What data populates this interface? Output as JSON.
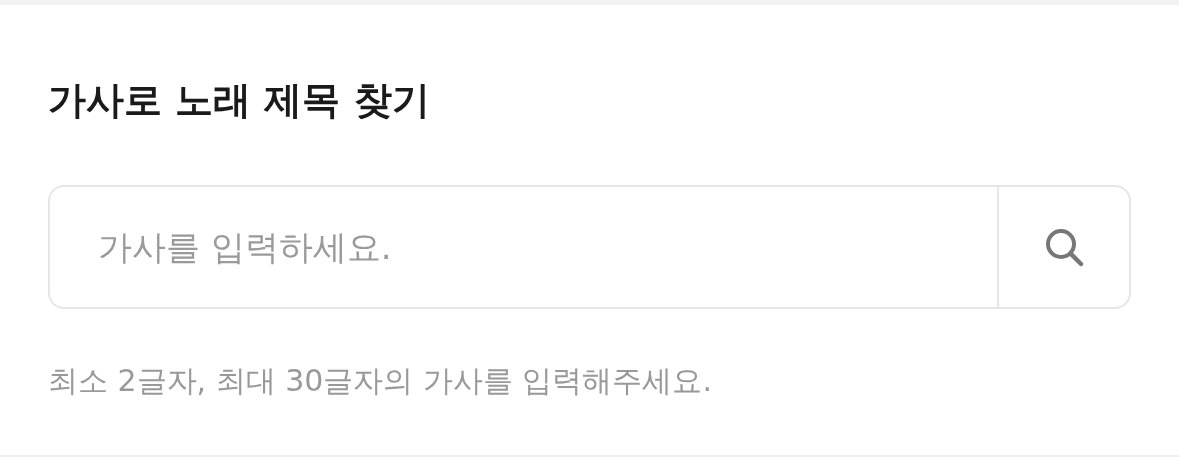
{
  "title": "가사로 노래 제목 찾기",
  "search": {
    "placeholder": "가사를 입력하세요."
  },
  "hint": "최소 2글자, 최대 30글자의 가사를 입력해주세요."
}
